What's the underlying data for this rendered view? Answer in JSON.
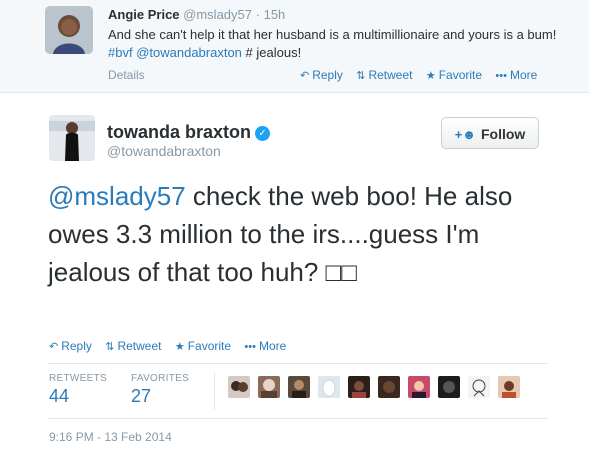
{
  "parent_tweet": {
    "name": "Angie Price",
    "handle": "@mslady57",
    "separator": "·",
    "time": "15h",
    "text_before": "And she can't help it that her husband is a multimillionaire and yours is a bum! ",
    "hashtag": "#bvf",
    "mention": "@towandabraxton",
    "text_after": " # jealous!",
    "details": "Details",
    "actions": {
      "reply": "Reply",
      "retweet": "Retweet",
      "favorite": "Favorite",
      "more": "More"
    }
  },
  "main_tweet": {
    "name": "towanda braxton",
    "handle": "@towandabraxton",
    "follow_label": "Follow",
    "mention": "@mslady57",
    "text": " check the web boo! He also owes 3.3 million to the irs....guess I'm jealous of that too huh? □□",
    "actions": {
      "reply": "Reply",
      "retweet": "Retweet",
      "favorite": "Favorite",
      "more": "More"
    },
    "stats": {
      "retweets_label": "RETWEETS",
      "retweets": "44",
      "favorites_label": "FAVORITES",
      "favorites": "27"
    },
    "timestamp": "9:16 PM - 13 Feb 2014"
  },
  "favoriters": [
    {
      "name": "favoriter-1"
    },
    {
      "name": "favoriter-2"
    },
    {
      "name": "favoriter-3"
    },
    {
      "name": "favoriter-4"
    },
    {
      "name": "favoriter-5"
    },
    {
      "name": "favoriter-6"
    },
    {
      "name": "favoriter-7"
    },
    {
      "name": "favoriter-8"
    },
    {
      "name": "favoriter-9"
    },
    {
      "name": "favoriter-10"
    }
  ],
  "colors": {
    "link": "#2b7bb9",
    "muted": "#8899a6",
    "verified": "#1da1f2",
    "parent_bg": "#f5f8fa"
  },
  "icons": {
    "reply": "reply-arrow-icon",
    "retweet": "retweet-icon",
    "favorite": "star-icon",
    "more": "ellipsis-icon",
    "follow": "add-user-icon",
    "verified": "verified-badge-icon"
  }
}
